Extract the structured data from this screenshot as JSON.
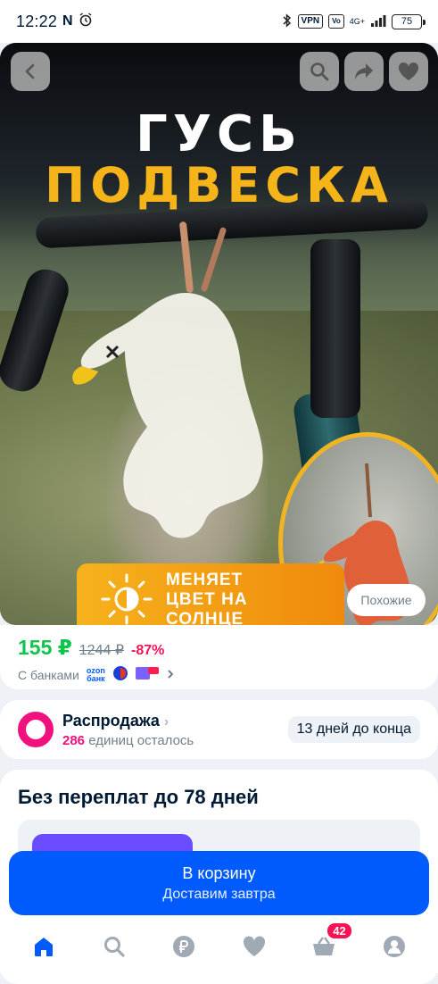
{
  "status_bar": {
    "time": "12:22",
    "vpn": "VPN",
    "network": "4G+",
    "battery": "75"
  },
  "hero": {
    "title_line1": "ГУСЬ",
    "title_line2": "ПОДВЕСКА",
    "badge_text_line1": "МЕНЯЕТ",
    "badge_text_line2": "ЦВЕТ НА",
    "badge_text_line3": "СОЛНЦЕ",
    "similar_label": "Похожие"
  },
  "price": {
    "current": "155 ₽",
    "old": "1244 ₽",
    "discount": "-87%",
    "banks_label": "С банками",
    "ozon_bank": "ozon банк"
  },
  "sale": {
    "title": "Распродажа",
    "units": "286",
    "units_label": "единиц осталось",
    "days_left": "13 дней до конца"
  },
  "payment": {
    "title": "Без переплат до 78 дней"
  },
  "cart": {
    "label": "В корзину",
    "sub": "Доставим завтра"
  },
  "tabbar": {
    "cart_badge": "42"
  },
  "colors": {
    "accent": "#005bff",
    "price_green": "#10c44c",
    "discount_red": "#f91155",
    "sale_pink": "#f1117e",
    "hero_yellow": "#f5b41a"
  }
}
